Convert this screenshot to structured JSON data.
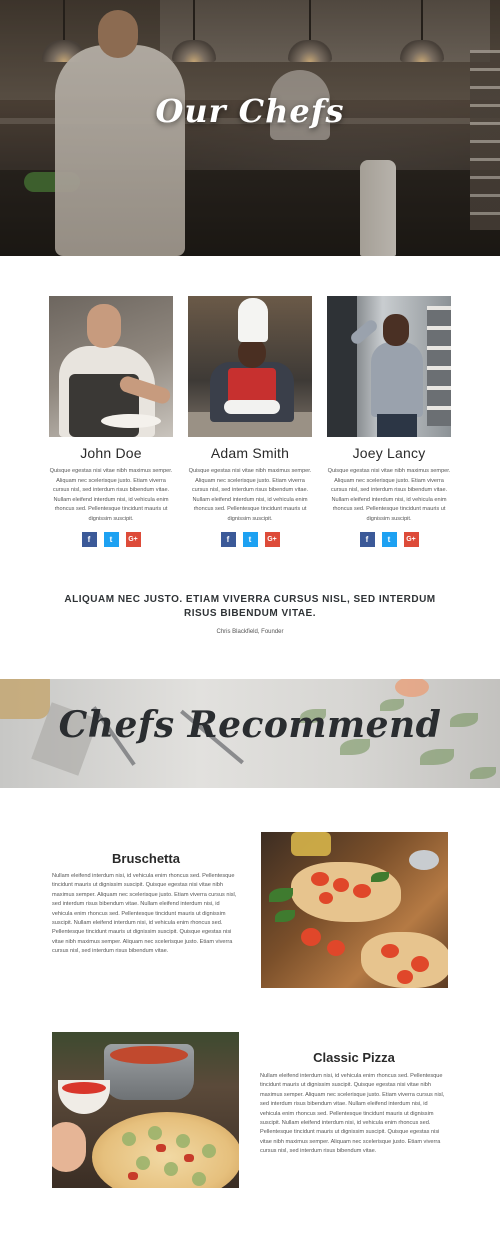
{
  "hero": {
    "title": "Our Chefs"
  },
  "chefs": [
    {
      "name": "John Doe",
      "bio": "Quisque egestas nisi vitae nibh maximus semper. Aliquam nec scelerisque justo. Etiam viverra cursus nisl, sed interdum risus bibendum vitae. Nullam eleifend interdum nisi, id vehicula enim rhoncus sed. Pellentesque tincidunt mauris ut dignissim suscipit.",
      "social": {
        "facebook": "f",
        "twitter": "t",
        "googleplus": "G+"
      }
    },
    {
      "name": "Adam Smith",
      "bio": "Quisque egestas nisi vitae nibh maximus semper. Aliquam nec scelerisque justo. Etiam viverra cursus nisl, sed interdum risus bibendum vitae. Nullam eleifend interdum nisi, id vehicula enim rhoncus sed. Pellentesque tincidunt mauris ut dignissim suscipit.",
      "social": {
        "facebook": "f",
        "twitter": "t",
        "googleplus": "G+"
      }
    },
    {
      "name": "Joey Lancy",
      "bio": "Quisque egestas nisi vitae nibh maximus semper. Aliquam nec scelerisque justo. Etiam viverra cursus nisl, sed interdum risus bibendum vitae. Nullam eleifend interdum nisi, id vehicula enim rhoncus sed. Pellentesque tincidunt mauris ut dignissim suscipit.",
      "social": {
        "facebook": "f",
        "twitter": "t",
        "googleplus": "G+"
      }
    }
  ],
  "quote": {
    "text": "ALIQUAM NEC JUSTO. ETIAM VIVERRA CURSUS NISL, SED INTERDUM RISUS BIBENDUM VITAE.",
    "author": "Chris Blackfield, Founder"
  },
  "recommend": {
    "title": "Chefs Recommend"
  },
  "dishes": [
    {
      "name": "Bruschetta",
      "description": "Nullam eleifend interdum nisi, id vehicula enim rhoncus sed. Pellentesque tincidunt mauris ut dignissim suscipit. Quisque egestas nisi vitae nibh maximus semper. Aliquam nec scelerisque justo. Etiam viverra cursus nisl, sed interdum risus bibendum vitae. Nullam eleifend interdum nisi, id vehicula enim rhoncus sed. Pellentesque tincidunt mauris ut dignissim suscipit. Nullam eleifend interdum nisi, id vehicula enim rhoncus sed. Pellentesque tincidunt mauris ut dignissim suscipit. Quisque egestas nisi vitae nibh maximus semper. Aliquam nec scelerisque justo. Etiam viverra cursus nisl, sed interdum risus bibendum vitae."
    },
    {
      "name": "Classic Pizza",
      "description": "Nullam eleifend interdum nisi, id vehicula enim rhoncus sed. Pellentesque tincidunt mauris ut dignissim suscipit. Quisque egestas nisi vitae nibh maximus semper. Aliquam nec scelerisque justo. Etiam viverra cursus nisl, sed interdum risus bibendum vitae. Nullam eleifend interdum nisi, id vehicula enim rhoncus sed. Pellentesque tincidunt mauris ut dignissim suscipit. Nullam eleifend interdum nisi, id vehicula enim rhoncus sed. Pellentesque tincidunt mauris ut dignissim suscipit. Quisque egestas nisi vitae nibh maximus semper. Aliquam nec scelerisque justo. Etiam viverra cursus nisl, sed interdum risus bibendum vitae."
    }
  ],
  "colors": {
    "facebook": "#3b5998",
    "twitter": "#1da1f2",
    "googleplus": "#dd4b39",
    "heading": "#2a2d30"
  }
}
